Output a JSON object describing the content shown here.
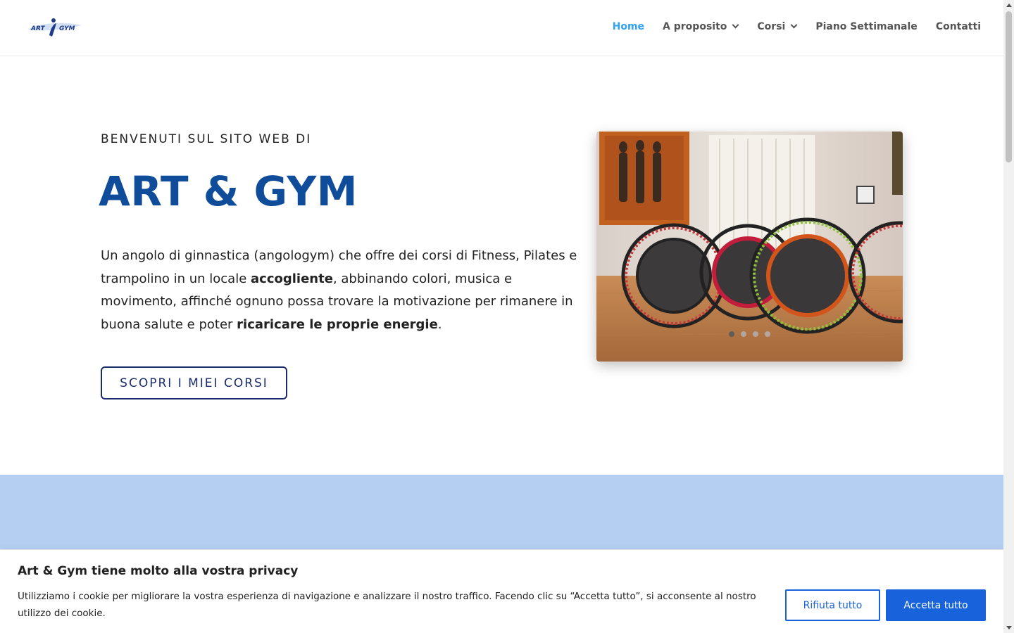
{
  "header": {
    "logo_text_left": "ART",
    "logo_text_right": "GYM",
    "nav": [
      {
        "label": "Home",
        "active": true,
        "has_dropdown": false
      },
      {
        "label": "A proposito",
        "active": false,
        "has_dropdown": true
      },
      {
        "label": "Corsi",
        "active": false,
        "has_dropdown": true
      },
      {
        "label": "Piano Settimanale",
        "active": false,
        "has_dropdown": false
      },
      {
        "label": "Contatti",
        "active": false,
        "has_dropdown": false
      }
    ]
  },
  "hero": {
    "kicker": "BENVENUTI SUL SITO WEB DI",
    "title": "ART & GYM",
    "text_parts": [
      "Un angolo di ginnastica (angologym) che offre dei corsi di Fitness, Pilates e trampolino in un locale ",
      "accogliente",
      ", abbinando colori, musica e movimento, affinché ognuno possa trovare la motivazione per rimanere in buona salute e poter ",
      "ricaricare le proprie energie",
      "."
    ],
    "cta_label": "SCOPRI I MIEI CORSI"
  },
  "slider": {
    "dot_count": 4,
    "active_index": 0
  },
  "cookie_banner": {
    "title": "Art & Gym tiene molto alla vostra privacy",
    "text": "Utilizziamo i cookie per migliorare la vostra esperienza di navigazione e analizzare il nostro traffico. Facendo clic su “Accetta tutto”, si acconsente al nostro utilizzo dei cookie.",
    "reject_label": "Rifiuta tutto",
    "accept_label": "Accetta tutto"
  },
  "colors": {
    "nav_active": "#2ea3f2",
    "title_blue": "#0f4d9b",
    "cta_border": "#1b2c6b",
    "band_blue": "#b5cff3",
    "cookie_primary": "#1863dc"
  }
}
